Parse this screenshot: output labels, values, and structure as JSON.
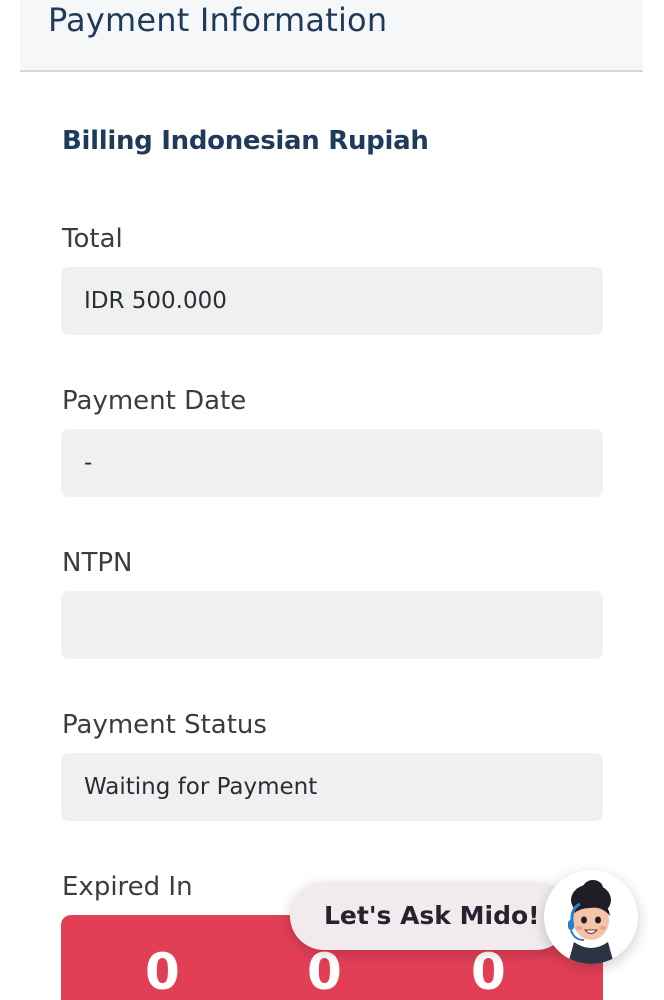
{
  "header": {
    "title": "Payment Information"
  },
  "billing": {
    "section_title": "Billing Indonesian Rupiah",
    "fields": [
      {
        "label": "Total",
        "value": "IDR 500.000"
      },
      {
        "label": "Payment Date",
        "value": "-"
      },
      {
        "label": "NTPN",
        "value": ""
      },
      {
        "label": "Payment Status",
        "value": "Waiting for Payment"
      }
    ],
    "expired_label": "Expired In",
    "countdown": [
      "0",
      "0",
      "0"
    ]
  },
  "chat": {
    "label": "Let's Ask Mido!",
    "avatar_icon": "mido-assistant-avatar"
  },
  "colors": {
    "header_text": "#1f3b5a",
    "field_bg": "#eef0f2",
    "countdown_bg": "#e23f57"
  }
}
